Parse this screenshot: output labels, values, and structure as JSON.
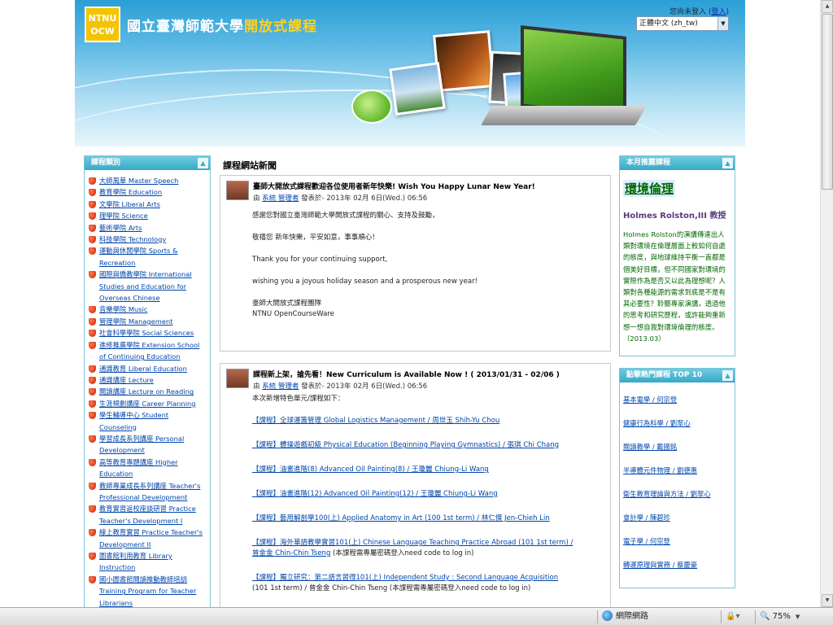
{
  "header": {
    "logo_line1": "NTNU",
    "logo_line2": "OCW",
    "title_main": "國立臺灣師範大學",
    "title_accent": "開放式課程",
    "login_text": "您尚未登入 (",
    "login_link": "登入",
    "login_close": ")",
    "language_selected": "正體中文 (zh_tw)"
  },
  "left": {
    "heading": "課程類別",
    "categories": [
      "大師風華 Master Speech",
      "教育學院 Education",
      "文學院 Liberal Arts",
      "理學院 Science",
      "藝術學院 Arts",
      "科技學院 Technology",
      "運動與休閒學院 Sports & Recreation",
      "國際與僑教學院 International Studies and Education for Overseas Chinese",
      "音樂學院 Music",
      "管理學院 Management",
      "社會科學學院 Social Sciences",
      "進修推廣學院 Extension School of Continuing Education",
      "通識教育 Liberal Education",
      "通識講座 Lecture",
      "閱讀講座 Lecture on Reading",
      "生涯規劃講座 Career Planning",
      "學生輔導中心 Student Counseling",
      "學習成長系列講座 Personal Development",
      "高等教育專題講座 Higher Education",
      "教師專業成長系列講座 Teacher's Professional Development",
      "教育實習返校座談研習 Practice Teacher's Development I",
      "線上教育實習 Practice Teacher's Development II",
      "圖書館利用教育 Library Instruction",
      "國小圖書館閱讀推動教師培訓 Training Program for Teacher Librarians"
    ]
  },
  "center": {
    "news_heading": "課程網站新聞",
    "post1": {
      "subject": "臺師大開放式課程歡迎各位使用者新年快樂! Wish You Happy Lunar New Year!",
      "by": "由",
      "author": "系統 管理者",
      "date": "發表於- 2013年 02月 6日(Wed.) 06:56",
      "lines": [
        "感謝您對國立臺灣師範大學開放式課程的關心、支持及鼓勵，",
        "敬禧您 新年快樂，平安如意，事事順心！",
        "Thank you for your continuing support,",
        "wishing you a joyous holiday season and a prosperous new year!"
      ],
      "sign1": "臺師大開放式課程團隊",
      "sign2": "NTNU OpenCourseWare"
    },
    "post2": {
      "subject": "課程新上架，搶先看！New Curriculum is Available Now ! ( 2013/01/31 - 02/06 )",
      "by": "由",
      "author": "系統 管理者",
      "date": "發表於- 2013年 02月 6日(Wed.) 06:56",
      "intro": "本次新增特色單元/課程如下：",
      "links": [
        "【課程】全球運籌管理 Global Logistics Management / 周世玉 Shih-Yu Chou",
        "【課程】體操遊戲初級 Physical Education (Beginning Playing Gymnastics) / 張琪 Chi Chang",
        "【課程】油畫進階(8) Advanced Oil Painting(8) / 王瓊麗 Chiung-Li Wang",
        "【課程】油畫進階(12) Advanced Oil Painting(12) / 王瓊麗 Chiung-Li Wang",
        "【課程】藝用解剖學100(上) Applied Anatomy in Art (100 1st term) / 林仁傑 Jen-Chieh Lin",
        "【課程】海外華語教學實習101(上) Chinese Language Teaching Practice Abroad (101 1st term) /",
        "【課程】獨立研究：第二語言習得101(上) Independent Study : Second Language Acquisition"
      ],
      "link6_extra_link": "曾金金 Chin-Chin Tseng",
      "link6_extra_text": " (本課程需專屬密碼登入need code to log in)",
      "link7_cont": "(101 1st term) / 曾金金 Chin-Chin Tseng (本課程需專屬密碼登入need code to log in)"
    }
  },
  "right": {
    "feature_heading": "本月推薦課程",
    "feature_title": "環境倫理",
    "feature_author": "Holmes Rolston,III 教授",
    "feature_desc": "Holmes Rolston的演講傳達出人類對環境在倫理層面上較如何自處的態度，與地球維持平衡一直都是個美好目標，但不同國家對環境的實際作為是否又以此為理想呢？人類對各種能源的需求到底是不是有其必要性？聆聽專家演講，透過他的思考和研究歷程，或許能夠重新想一想自我對環境倫理的態度。（2013.03）",
    "top10_heading": "點擊熱門課程 TOP 10",
    "top10": [
      "基本電學 / 何宗登",
      "健康行為科學 / 劉翠心",
      "閱讀教學 / 戴國銘",
      "半導體元件物理 / 劉德惠",
      "衛生教育理論與方法 / 劉翠心",
      "會計學 / 陳碧珍",
      "電子學 / 何宗登",
      "轉運原理與實務 / 蔡慶豪"
    ]
  },
  "statusbar": {
    "zone": "網際網路",
    "zoom": "75%"
  },
  "colors": {
    "accent": "#37a9c7",
    "link": "#0044aa",
    "feature_green": "#006600"
  }
}
